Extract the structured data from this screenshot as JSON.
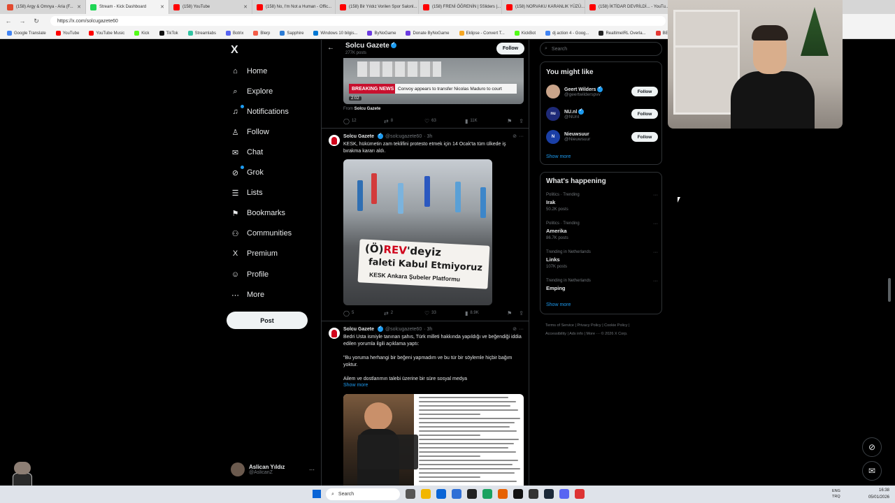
{
  "browser": {
    "tabs": [
      {
        "title": "(158) Argy & Omnya - Aria (F...",
        "color": "#e24a2f",
        "active": false
      },
      {
        "title": "Stream - Kick Dashboard",
        "color": "#1fd655",
        "active": true
      },
      {
        "title": "(158) YouTube",
        "color": "#ff0000",
        "active": false
      },
      {
        "title": "(158) No, I'm Not a Human - Offic...",
        "color": "#ff0000",
        "active": false
      },
      {
        "title": "(158) Bir Yıldız Vorilen Spor Salonl...",
        "color": "#ff0000",
        "active": false
      },
      {
        "title": "(158) FRENİ ÖĞRENİN | 5Sliders |...",
        "color": "#ff0000",
        "active": false
      },
      {
        "title": "(158) NORVAKU KARANLIK YÜZÜ...",
        "color": "#ff0000",
        "active": false
      },
      {
        "title": "(158) İKTİDAR DEVRİLDİ... - YouTu...",
        "color": "#ff0000",
        "active": false
      }
    ],
    "url": "https://x.com/solcugazete60",
    "bookmarks": [
      {
        "label": "Google Translate",
        "color": "#4285f4"
      },
      {
        "label": "YouTube",
        "color": "#ff0000"
      },
      {
        "label": "YouTube Music",
        "color": "#ff0000"
      },
      {
        "label": "Kick",
        "color": "#53fc18"
      },
      {
        "label": "TikTok",
        "color": "#111111"
      },
      {
        "label": "Streamlabs",
        "color": "#31c3a2"
      },
      {
        "label": "Botrix",
        "color": "#5865f2"
      },
      {
        "label": "Blerp",
        "color": "#f45d48"
      },
      {
        "label": "Sapphire",
        "color": "#2b7bd4"
      },
      {
        "label": "Windows 10 bilgis...",
        "color": "#0078d4"
      },
      {
        "label": "ByNoGame",
        "color": "#6c3ce1"
      },
      {
        "label": "Donate ByNoGame",
        "color": "#6c3ce1"
      },
      {
        "label": "Eklipse - Convert T...",
        "color": "#f5a623"
      },
      {
        "label": "KickBot",
        "color": "#53fc18"
      },
      {
        "label": "dj action 4 - Goog...",
        "color": "#4285f4"
      },
      {
        "label": "RealtimeIRL Overla...",
        "color": "#222222"
      },
      {
        "label": "BELABOX",
        "color": "#e53935"
      }
    ]
  },
  "nav": {
    "logo": "X",
    "items": [
      {
        "label": "Home",
        "icon": "home-icon",
        "glyph": "⌂"
      },
      {
        "label": "Explore",
        "icon": "search-icon",
        "glyph": "⌕"
      },
      {
        "label": "Notifications",
        "icon": "bell-icon",
        "glyph": "♫"
      },
      {
        "label": "Follow",
        "icon": "person-add-icon",
        "glyph": "♙"
      },
      {
        "label": "Chat",
        "icon": "mail-icon",
        "glyph": "✉"
      },
      {
        "label": "Grok",
        "icon": "grok-icon",
        "glyph": "⊘"
      },
      {
        "label": "Lists",
        "icon": "list-icon",
        "glyph": "☰"
      },
      {
        "label": "Bookmarks",
        "icon": "bookmark-icon",
        "glyph": "⚑"
      },
      {
        "label": "Communities",
        "icon": "communities-icon",
        "glyph": "⚇"
      },
      {
        "label": "Premium",
        "icon": "x-premium-icon",
        "glyph": "X"
      },
      {
        "label": "Profile",
        "icon": "profile-icon",
        "glyph": "☺"
      },
      {
        "label": "More",
        "icon": "more-circle-icon",
        "glyph": "⋯"
      }
    ],
    "post_label": "Post",
    "account": {
      "name": "Aslican Yıldız",
      "handle": "@AslicanZ",
      "more": "···"
    }
  },
  "profile_header": {
    "name": "Solcu Gazete",
    "posts": "277K posts",
    "follow_label": "Follow",
    "back_glyph": "←"
  },
  "tweets": [
    {
      "video_breaking": "BREAKING NEWS",
      "video_caption": "Convoy appears to transfer Nicolas Maduro to court",
      "video_time": "2:02",
      "from_label": "From",
      "from_name": "Solcu Gazete",
      "replies": "12",
      "reposts": "8",
      "likes": "63",
      "views": "11K"
    },
    {
      "name": "Solcu Gazete",
      "handle": "@solcugazete60",
      "time": "· 3h",
      "more": "···",
      "text": "KESK, hükümetin zam teklifini protesto etmek için 14 Ocak'ta tüm ülkede iş bırakma kararı aldı.",
      "banner_line1_pre": "(Ö)",
      "banner_line1_red": "REV",
      "banner_line1_post": "'deyiz",
      "banner_line2": "faleti Kabul Etmiyoruz",
      "banner_line3": "KESK Ankara Şubeler Platformu",
      "replies": "5",
      "reposts": "2",
      "likes": "33",
      "views": "8.9K"
    },
    {
      "name": "Solcu Gazete",
      "handle": "@solcugazete60",
      "time": "· 3h",
      "more": "···",
      "text": "Bedri Usta ismiyle tanınan şahıs, Türk milleti hakkında yapıldığı ve beğendiği iddia edilen yorumla ilgili açıklama yaptı:",
      "quote": "\"Bu yoruma herhangi bir beğeni yapmadım ve bu tür bir söylemle hiçbir bağım yoktur.",
      "quote2": "Ailem ve dostlarımın talebi üzerine bir süre sosyal medya",
      "show_more": "Show more"
    }
  ],
  "right": {
    "search_placeholder": "Search",
    "suggest_title": "You might like",
    "suggestions": [
      {
        "name": "Geert Wilders",
        "handle": "@geertwilderspvv",
        "verified": true,
        "avatar_color": "#c9a48a",
        "initials": "",
        "follow": "Follow"
      },
      {
        "name": "NU.nl",
        "handle": "@NUnl",
        "verified": true,
        "avatar_color": "#1e2a78",
        "initials": "nu",
        "follow": "Follow"
      },
      {
        "name": "Nieuwsuur",
        "handle": "@Nieuwsuur",
        "verified": false,
        "avatar_color": "#1a3fa6",
        "initials": "N",
        "follow": "Follow"
      }
    ],
    "suggest_more": "Show more",
    "happening_title": "What's happening",
    "trends": [
      {
        "category": "Politics · Trending",
        "name": "Irak",
        "count": "50.2K posts"
      },
      {
        "category": "Politics · Trending",
        "name": "Amerika",
        "count": "86.7K posts"
      },
      {
        "category": "Trending in Netherlands",
        "name": "Links",
        "count": "107K posts"
      },
      {
        "category": "Trending in Netherlands",
        "name": "Emping",
        "count": ""
      }
    ],
    "trends_more": "Show more",
    "footer_line1": "Terms of Service  |  Privacy Policy  |  Cookie Policy  |",
    "footer_line2": "Accessibility  |  Ads info  |  More ···  © 2026 X Corp."
  },
  "taskbar": {
    "search": "Search",
    "lang": "ENG",
    "lang2": "TRQ",
    "time": "16:38",
    "date": "05/01/2026"
  }
}
